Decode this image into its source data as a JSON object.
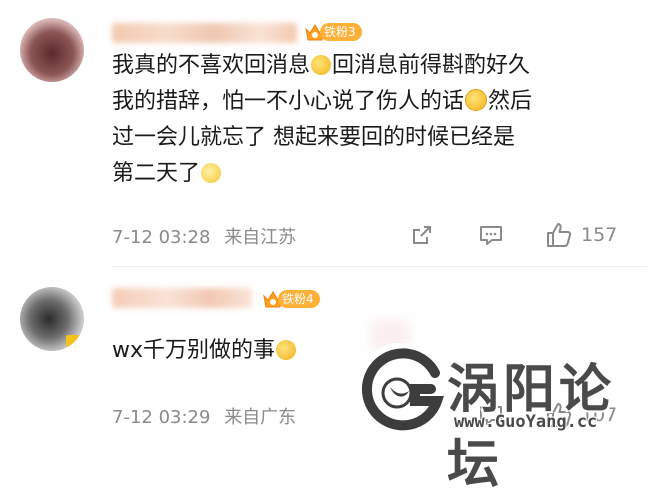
{
  "comments": [
    {
      "fan_badge": "铁粉3",
      "content_lines": [
        [
          "我真的不喜欢回消息",
          "emoji:laugh",
          "回消息前得斟酌好久"
        ],
        [
          "我的措辞，怕一不小心说了伤人的话",
          "emoji:cry",
          "然后"
        ],
        [
          "过一会儿就忘了 想起来要回的时候已经是"
        ],
        [
          "第二天了",
          "emoji:chick"
        ]
      ],
      "line1_a": "我真的不喜欢回消息",
      "line1_b": "回消息前得斟酌好久",
      "line2_a": "我的措辞，怕一不小心说了伤人的话",
      "line2_b": "然后",
      "line3": "过一会儿就忘了 想起来要回的时候已经是",
      "line4": "第二天了",
      "time": "7-12 03:28",
      "location": "来自江苏",
      "like_count": "157"
    },
    {
      "fan_badge": "铁粉4",
      "text": "wx千万别做的事",
      "time": "7-12 03:29",
      "location": "来自广东",
      "like_count": "107"
    }
  ],
  "watermark": {
    "title": "涡阳论坛",
    "url": "www.GuoYang.cc"
  },
  "icons": {
    "share": "share-icon",
    "reply": "comment-icon",
    "like": "thumbs-up-icon"
  },
  "colors": {
    "fan_badge": "#ffb038",
    "meta_text": "#8a8a8a"
  }
}
